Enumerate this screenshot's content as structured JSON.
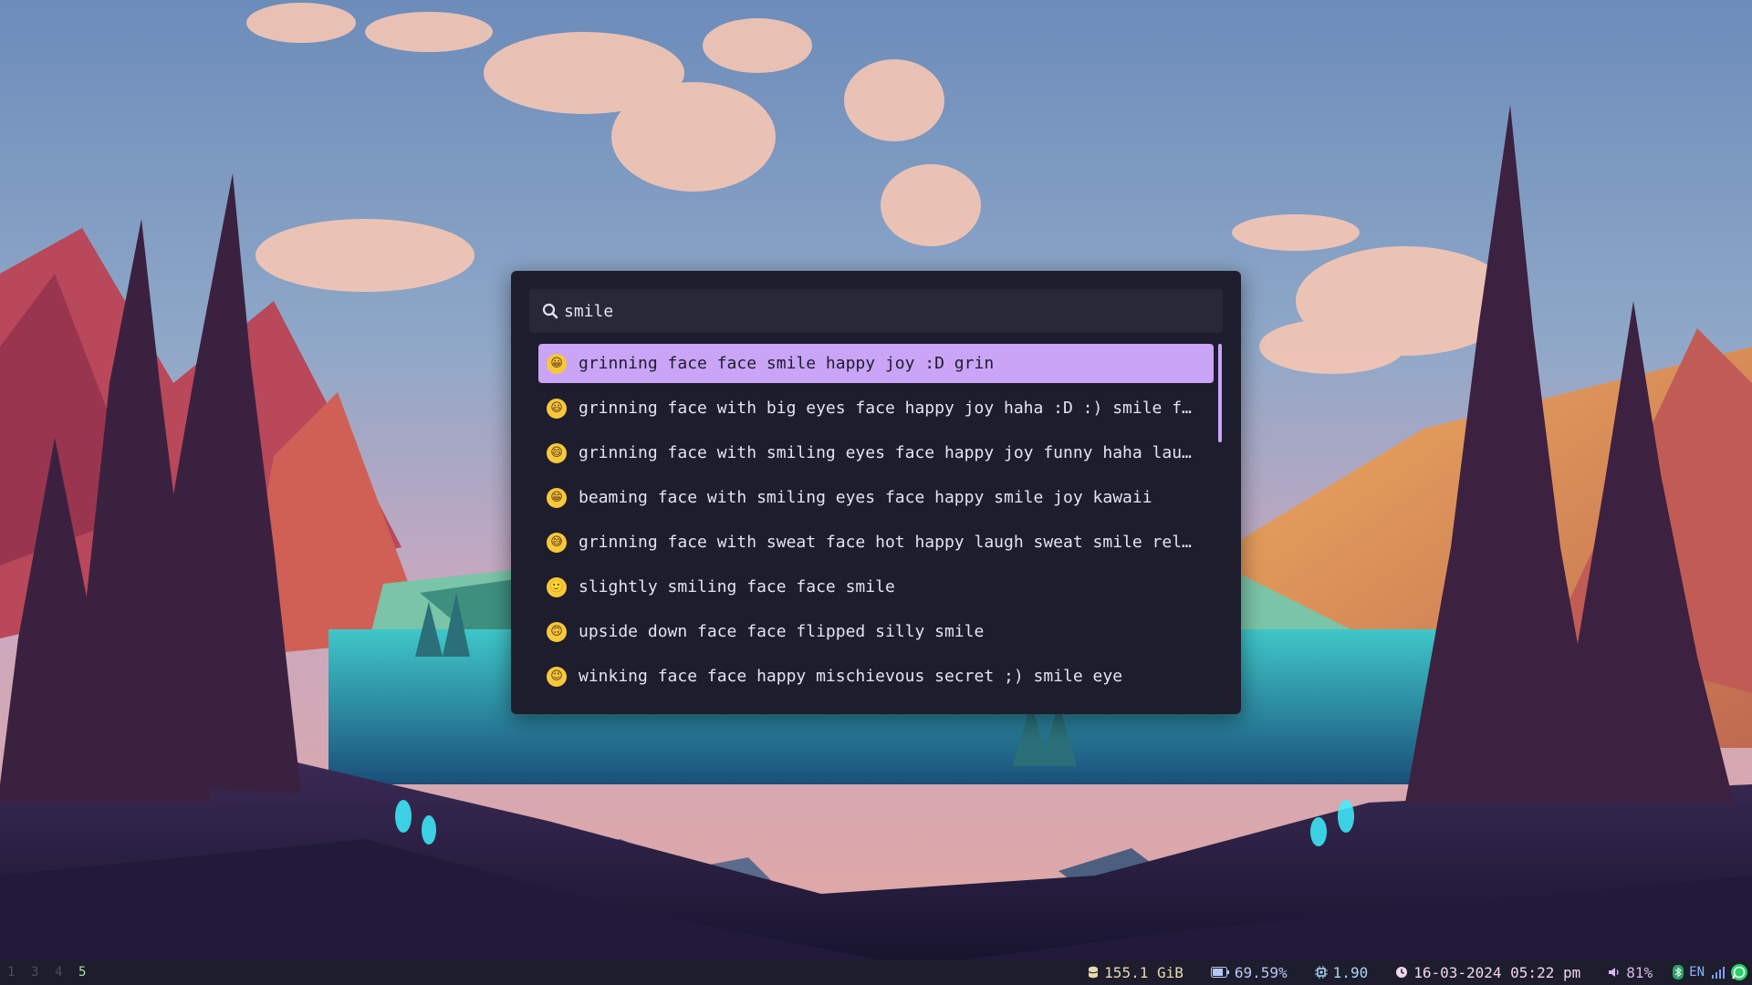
{
  "launcher": {
    "query": "smile",
    "results": [
      {
        "emoji": "😀",
        "text": "grinning face face smile happy joy :D grin"
      },
      {
        "emoji": "😃",
        "text": "grinning face with big eyes face happy joy haha :D :) smile f…"
      },
      {
        "emoji": "😄",
        "text": "grinning face with smiling eyes face happy joy funny haha lau…"
      },
      {
        "emoji": "😁",
        "text": "beaming face with smiling eyes face happy smile joy kawaii"
      },
      {
        "emoji": "😅",
        "text": "grinning face with sweat face hot happy laugh sweat smile rel…"
      },
      {
        "emoji": "🙂",
        "text": "slightly smiling face face smile"
      },
      {
        "emoji": "🙃",
        "text": "upside down face face flipped silly smile"
      },
      {
        "emoji": "😉",
        "text": "winking face face happy mischievous secret ;) smile eye"
      }
    ]
  },
  "statusbar": {
    "workspaces": [
      "1",
      "3",
      "4",
      "5"
    ],
    "active_workspace": "5",
    "disk": "155.1 GiB",
    "battery": "69.59%",
    "cpu_load": "1.90",
    "datetime": "16-03-2024 05:22 pm",
    "volume": "81%",
    "language": "EN"
  },
  "colors": {
    "launcher_bg": "#1e1d2d",
    "search_bg": "#292839",
    "accent": "#c9a4f7",
    "text": "#e4e4ef",
    "active_workspace": "#a6e3a1"
  }
}
